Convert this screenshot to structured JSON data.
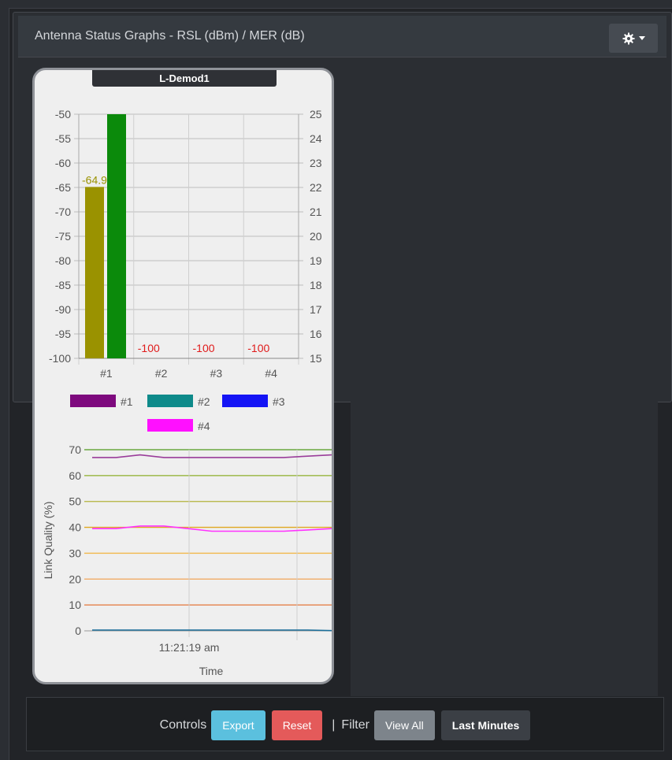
{
  "panel": {
    "title": "Antenna Status Graphs - RSL (dBm) / MER (dB)",
    "settings_icon": "gear-icon"
  },
  "card": {
    "title": "L-Demod1"
  },
  "chart_data": [
    {
      "type": "bar",
      "categories": [
        "#1",
        "#2",
        "#3",
        "#4"
      ],
      "series": [
        {
          "name": "RSL (dBm)",
          "axis": "left",
          "values": [
            -64.9,
            -100,
            -100,
            -100
          ],
          "color": "#9a9200"
        },
        {
          "name": "MER (dB)",
          "axis": "right",
          "values": [
            25,
            15,
            15,
            15
          ],
          "color": "#0b8a0b"
        }
      ],
      "data_labels": [
        "-64.9",
        "-100",
        "-100",
        "-100"
      ],
      "data_label_colors": [
        "#9a9200",
        "#e01b1b",
        "#e01b1b",
        "#e01b1b"
      ],
      "y_left_ticks": [
        "-50",
        "-55",
        "-60",
        "-65",
        "-70",
        "-75",
        "-80",
        "-85",
        "-90",
        "-95",
        "-100"
      ],
      "y_right_ticks": [
        "25",
        "24",
        "23",
        "22",
        "21",
        "20",
        "19",
        "18",
        "17",
        "16",
        "15"
      ],
      "ylim_left": [
        -100,
        -50
      ],
      "ylim_right": [
        15,
        25
      ],
      "grid": true
    },
    {
      "type": "line",
      "xlabel": "Time",
      "ylabel": "Link Quality (%)",
      "ylim": [
        0,
        70
      ],
      "y_ticks": [
        "70",
        "60",
        "50",
        "40",
        "30",
        "20",
        "10",
        "0"
      ],
      "x_ticks": [
        "11:21:19 am"
      ],
      "legend": [
        {
          "name": "#1",
          "color": "#7e0a7e"
        },
        {
          "name": "#2",
          "color": "#0e8a8a"
        },
        {
          "name": "#3",
          "color": "#1414f5"
        },
        {
          "name": "#4",
          "color": "#ff10ff"
        }
      ],
      "series": [
        {
          "name": "#1",
          "color": "#9a3d9a",
          "values": [
            67,
            67,
            68,
            67,
            67,
            67,
            67,
            67,
            67,
            67.5,
            68
          ]
        },
        {
          "name": "#4",
          "color": "#ff33ff",
          "values": [
            39.5,
            39.5,
            40.5,
            40.5,
            39.5,
            38.5,
            38.5,
            38.5,
            38.5,
            39,
            39.5
          ]
        },
        {
          "name": "#2",
          "color": "#1a6e9a",
          "values": [
            0.3,
            0.3,
            0.3,
            0.3,
            0.3,
            0.3,
            0.3,
            0.3,
            0.3,
            0.3,
            0.1
          ]
        }
      ],
      "threshold_lines": [
        {
          "value": 70,
          "color": "#4f9a1c"
        },
        {
          "value": 60,
          "color": "#8eaf2a"
        },
        {
          "value": 50,
          "color": "#b3b23a"
        },
        {
          "value": 40,
          "color": "#e0a71f"
        },
        {
          "value": 30,
          "color": "#f2b84a"
        },
        {
          "value": 20,
          "color": "#f0a458"
        },
        {
          "value": 10,
          "color": "#e3773a"
        }
      ]
    }
  ],
  "footer": {
    "controls_label": "Controls",
    "export_label": "Export",
    "reset_label": "Reset",
    "separator": "|",
    "filter_label": "Filter",
    "view_all_label": "View All",
    "last_minutes_label": "Last Minutes"
  }
}
